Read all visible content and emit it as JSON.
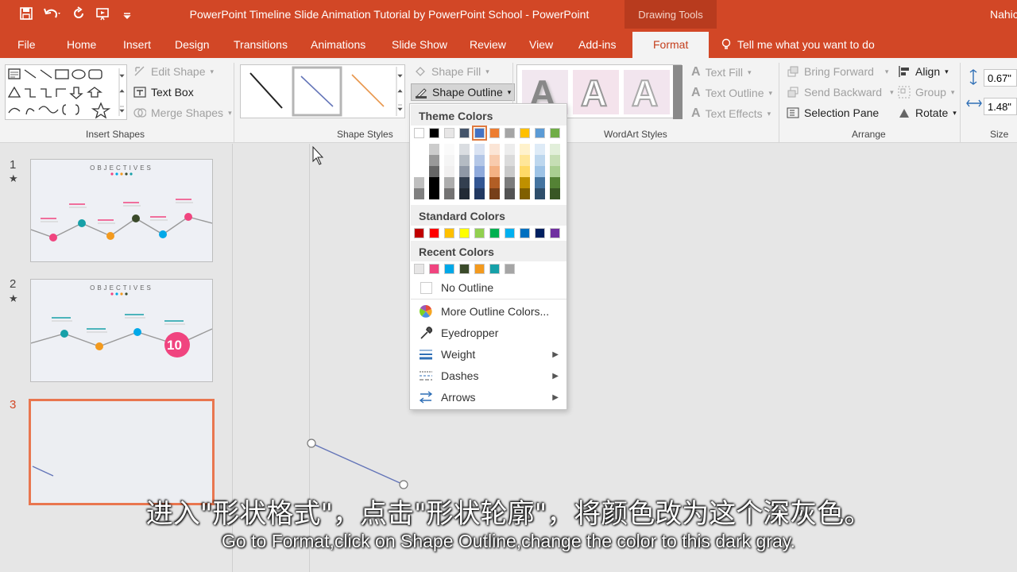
{
  "titlebar": {
    "title": "PowerPoint Timeline Slide Animation Tutorial by PowerPoint School  -  PowerPoint",
    "drawing_tools": "Drawing Tools",
    "user": "Nahic"
  },
  "tabs": [
    "File",
    "Home",
    "Insert",
    "Design",
    "Transitions",
    "Animations",
    "Slide Show",
    "Review",
    "View",
    "Add-ins",
    "Format"
  ],
  "tell_me": "Tell me what you want to do",
  "ribbon": {
    "insert_shapes": {
      "label": "Insert Shapes",
      "edit_shape": "Edit Shape",
      "text_box": "Text Box",
      "merge_shapes": "Merge Shapes"
    },
    "shape_styles": {
      "label": "Shape Styles",
      "shape_fill": "Shape Fill",
      "shape_outline": "Shape Outline"
    },
    "wordart": {
      "label": "WordArt Styles",
      "text_fill": "Text Fill",
      "text_outline": "Text Outline",
      "text_effects": "Text Effects",
      "glyph": "A"
    },
    "arrange": {
      "label": "Arrange",
      "bring_forward": "Bring Forward",
      "send_backward": "Send Backward",
      "selection_pane": "Selection Pane",
      "align": "Align",
      "group": "Group",
      "rotate": "Rotate"
    },
    "size": {
      "label": "Size",
      "height": "0.67\"",
      "width": "1.48\""
    }
  },
  "slides": [
    {
      "num": "1",
      "star": "★",
      "title": "OBJECTIVES"
    },
    {
      "num": "2",
      "star": "★",
      "title": "OBJECTIVES",
      "badge": "10"
    },
    {
      "num": "3"
    }
  ],
  "menu": {
    "theme_colors": "Theme Colors",
    "standard_colors": "Standard Colors",
    "recent_colors": "Recent Colors",
    "no_outline": "No Outline",
    "more_colors": "More Outline Colors...",
    "eyedropper": "Eyedropper",
    "weight": "Weight",
    "dashes": "Dashes",
    "arrows": "Arrows",
    "theme_row": [
      "#ffffff",
      "#000000",
      "#e7e6e6",
      "#44546a",
      "#4472c4",
      "#ed7d31",
      "#a5a5a5",
      "#ffc000",
      "#5b9bd5",
      "#70ad47"
    ],
    "standard_row": [
      "#c00000",
      "#ff0000",
      "#ffc000",
      "#ffff00",
      "#92d050",
      "#00b050",
      "#00b0f0",
      "#0070c0",
      "#002060",
      "#7030a0"
    ],
    "recent_row": [
      "#e7e6e6",
      "#f0447f",
      "#00a8e8",
      "#3a4a2a",
      "#f39a1e",
      "#16a0a8",
      "#a5a5a5"
    ]
  },
  "subtitles": {
    "cn": "进入\"形状格式\"，点击\"形状轮廓\"，将颜色改为这个深灰色。",
    "en": "Go to Format,click on Shape Outline,change the color to this dark gray."
  }
}
